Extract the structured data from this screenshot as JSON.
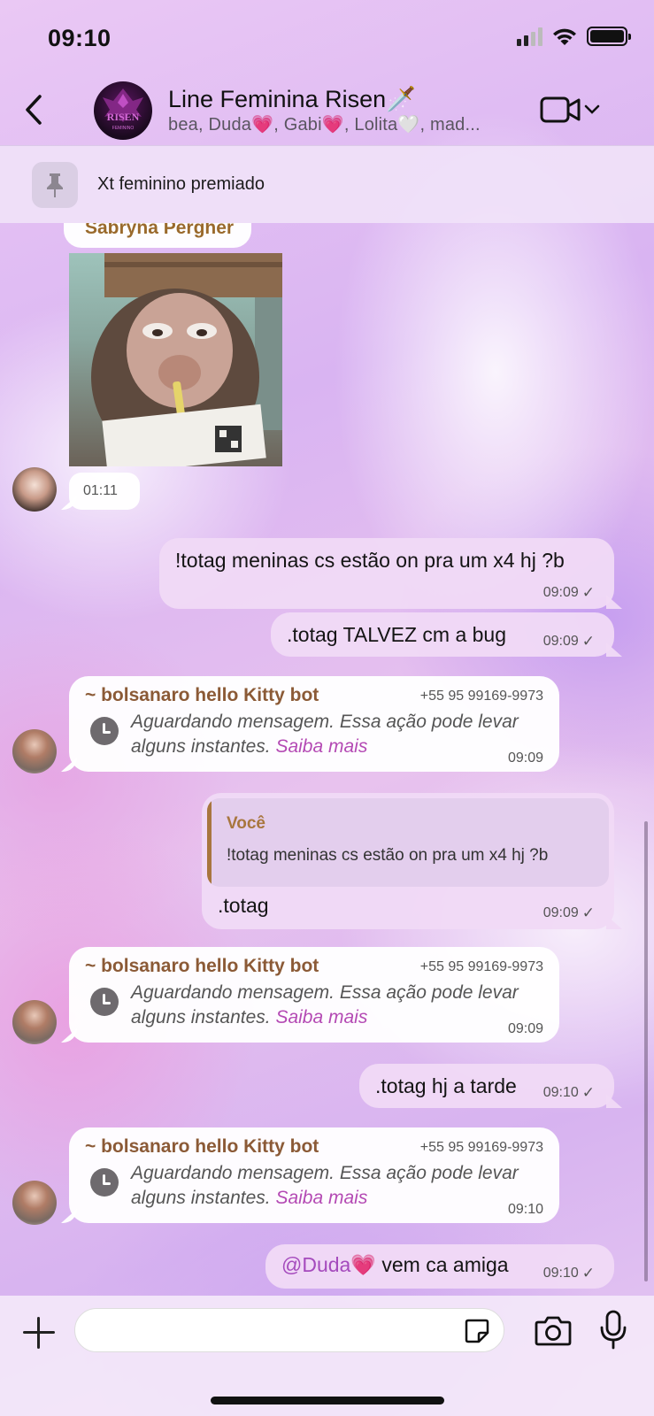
{
  "status": {
    "time": "09:10"
  },
  "header": {
    "title": "Line Feminina Risen🗡️",
    "subtitle": "bea, Duda💗, Gabi💗, Lolita🤍, mad...",
    "avatar_text": "RISEN",
    "avatar_subtext": "FEMININO"
  },
  "pinned": {
    "text": "Xt feminino premiado"
  },
  "messages": [
    {
      "sender": "Sabryna Pergher",
      "time": "01:11"
    },
    {
      "text": "!totag meninas cs estão on pra um x4 hj ?b",
      "time": "09:09",
      "status": "✓"
    },
    {
      "text": ".totag TALVEZ cm a bug",
      "time": "09:09",
      "status": "✓"
    },
    {
      "sender": "~ bolsanaro hello Kitty bot",
      "phone": "+55 95 99169-9973",
      "waiting": "Aguardando mensagem. Essa ação pode levar alguns instantes.",
      "link": "Saiba mais",
      "time": "09:09"
    },
    {
      "reply_name": "Você",
      "reply_text": "!totag meninas cs estão on pra um x4 hj ?b",
      "text": ".totag",
      "time": "09:09",
      "status": "✓"
    },
    {
      "sender": "~ bolsanaro hello Kitty bot",
      "phone": "+55 95 99169-9973",
      "waiting": "Aguardando mensagem. Essa ação pode levar alguns instantes.",
      "link": "Saiba mais",
      "time": "09:09"
    },
    {
      "text": ".totag hj a tarde",
      "time": "09:10",
      "status": "✓"
    },
    {
      "sender": "~ bolsanaro hello Kitty bot",
      "phone": "+55 95 99169-9973",
      "waiting": "Aguardando mensagem. Essa ação pode levar alguns instantes.",
      "link": "Saiba mais",
      "time": "09:10"
    },
    {
      "mention": "@Duda💗",
      "text": " vem ca amiga",
      "time": "09:10",
      "status": "✓"
    }
  ],
  "colors": {
    "sender": "#8b5a36",
    "link": "#b44ab4",
    "reply_accent": "#a8763e"
  },
  "icons": [
    "back-icon",
    "video-call-icon",
    "chevron-down-icon",
    "pin-icon",
    "clock-icon",
    "plus-icon",
    "sticker-icon",
    "camera-icon",
    "mic-icon"
  ]
}
